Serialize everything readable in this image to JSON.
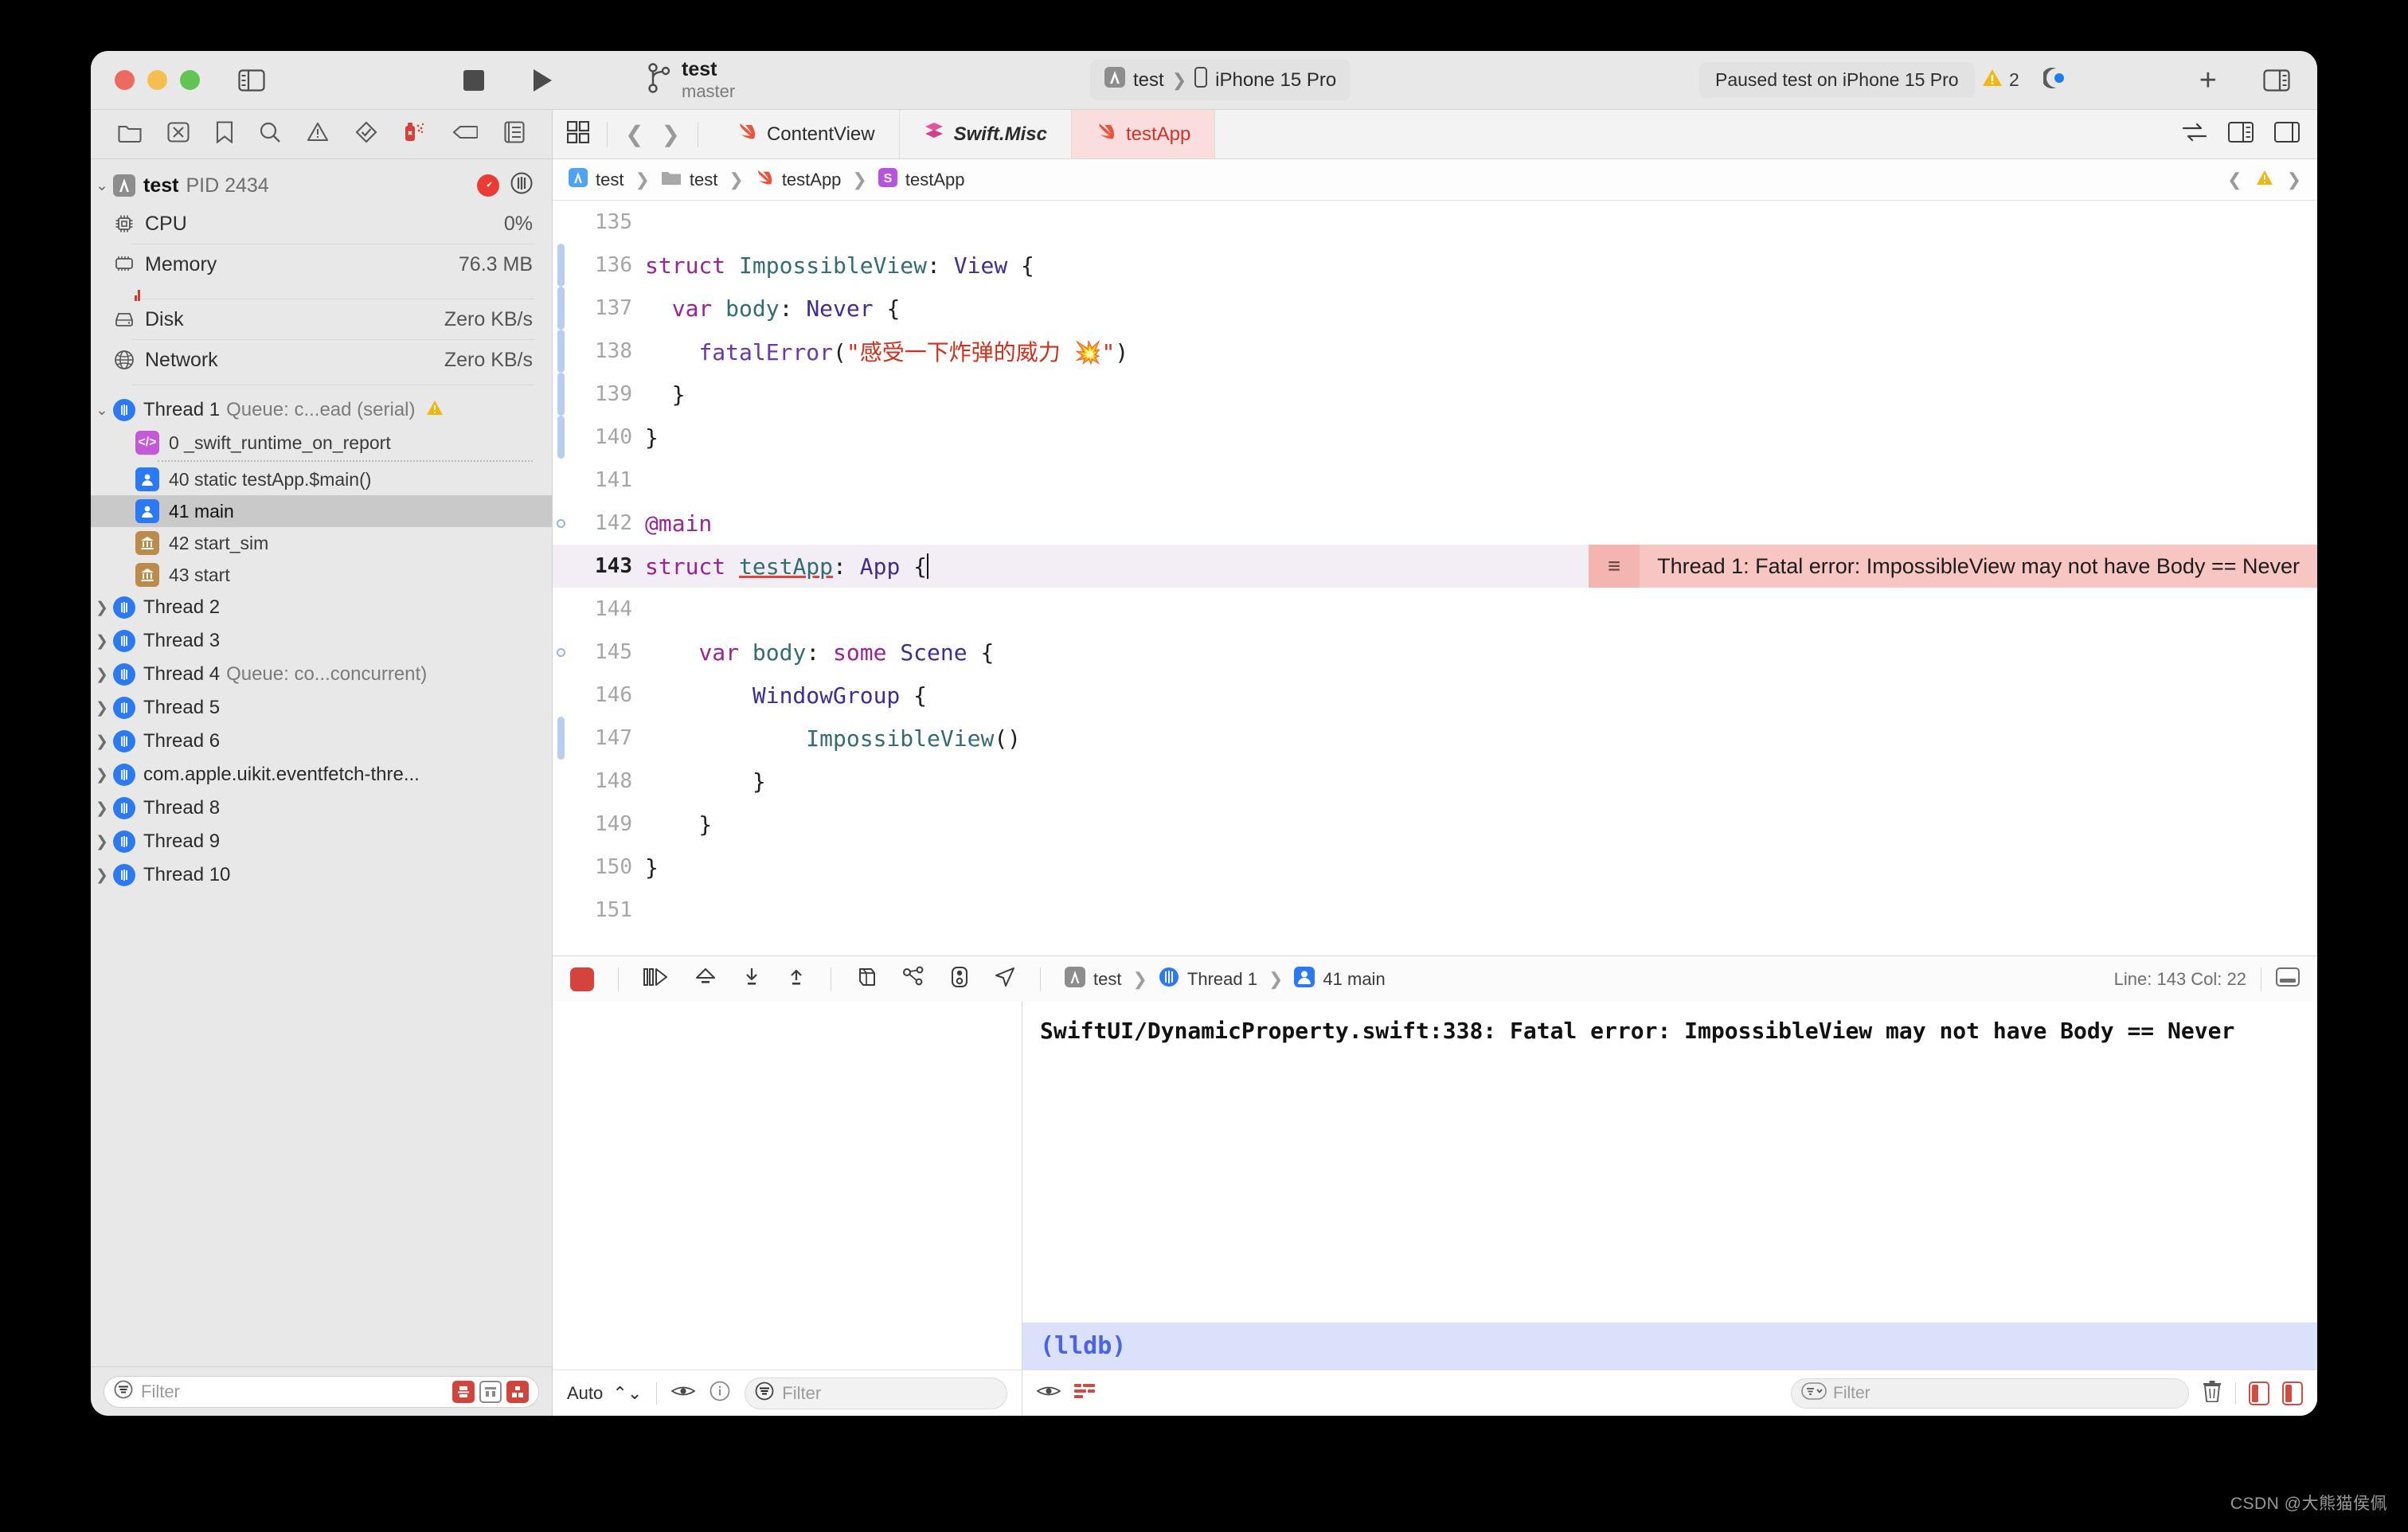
{
  "window": {
    "traffic": [
      "close",
      "minimize",
      "zoom"
    ]
  },
  "toolbar": {
    "project_name": "test",
    "branch": "master",
    "scheme_target": "test",
    "scheme_device": "iPhone 15 Pro",
    "status": "Paused test on iPhone 15 Pro",
    "warning_count": "2",
    "add_label": "+",
    "icons": {
      "sidebar_toggle": "sidebar-left-icon",
      "stop": "stop-icon",
      "run": "run-icon",
      "branch": "source-control-branch-icon",
      "app": "app-icon",
      "device": "iphone-icon",
      "warning": "warning-triangle-icon",
      "activity": "activity-icon",
      "add": "add-icon",
      "inspector_toggle": "sidebar-right-icon"
    }
  },
  "navigator": {
    "tabs": [
      "folder-icon",
      "source-control-icon",
      "bookmark-icon",
      "search-icon",
      "warning-triangle-icon",
      "test-diamond-icon",
      "debug-spray-icon",
      "breakpoint-tag-icon",
      "report-list-icon"
    ],
    "process": {
      "name": "test",
      "pid": "PID 2434",
      "gauge_badge": "performance-gauge-icon",
      "thread_badge": "thread-icon"
    },
    "gauges": [
      {
        "icon": "cpu-icon",
        "label": "CPU",
        "value": "0%"
      },
      {
        "icon": "memory-icon",
        "label": "Memory",
        "value": "76.3 MB"
      },
      {
        "icon": "disk-icon",
        "label": "Disk",
        "value": "Zero KB/s"
      },
      {
        "icon": "network-icon",
        "label": "Network",
        "value": "Zero KB/s"
      }
    ],
    "thread1": {
      "name": "Thread 1",
      "queue": "Queue: c...ead (serial)",
      "warning": "warning-triangle-icon"
    },
    "frames": [
      {
        "label": "0 _swift_runtime_on_report",
        "icon": "code-frame-icon",
        "kind": "purple",
        "selected": false
      },
      {
        "label": "40 static testApp.$main()",
        "icon": "user-frame-icon",
        "kind": "blue",
        "selected": false
      },
      {
        "label": "41 main",
        "icon": "user-frame-icon",
        "kind": "blue",
        "selected": true
      },
      {
        "label": "42 start_sim",
        "icon": "system-frame-icon",
        "kind": "tan",
        "selected": false
      },
      {
        "label": "43 start",
        "icon": "system-frame-icon",
        "kind": "tan",
        "selected": false
      }
    ],
    "threads": [
      {
        "name": "Thread 2",
        "queue": ""
      },
      {
        "name": "Thread 3",
        "queue": ""
      },
      {
        "name": "Thread 4",
        "queue": "Queue: co...concurrent)"
      },
      {
        "name": "Thread 5",
        "queue": ""
      },
      {
        "name": "Thread 6",
        "queue": ""
      },
      {
        "name": "com.apple.uikit.eventfetch-thre...",
        "queue": ""
      },
      {
        "name": "Thread 8",
        "queue": ""
      },
      {
        "name": "Thread 9",
        "queue": ""
      },
      {
        "name": "Thread 10",
        "queue": ""
      }
    ],
    "filter_placeholder": "Filter"
  },
  "editor": {
    "tabs": [
      {
        "label": "ContentView",
        "icon": "swift-file-icon",
        "active": false,
        "italic": false
      },
      {
        "label": "Swift.Misc",
        "icon": "swift-module-icon",
        "active": false,
        "italic": true
      },
      {
        "label": "testApp",
        "icon": "swift-file-icon",
        "active": true,
        "italic": false
      }
    ],
    "breadcrumb": [
      {
        "label": "test",
        "icon": "project-icon"
      },
      {
        "label": "test",
        "icon": "folder-icon"
      },
      {
        "label": "testApp",
        "icon": "swift-file-icon"
      },
      {
        "label": "testApp",
        "icon": "symbol-struct-icon"
      }
    ],
    "code_lines": [
      {
        "n": "135",
        "segments": [],
        "marker": "",
        "current": false
      },
      {
        "n": "136",
        "marker": "bar",
        "current": false,
        "segments": [
          {
            "t": "struct ",
            "c": "kw"
          },
          {
            "t": "ImpossibleView",
            "c": "ident-teal"
          },
          {
            "t": ": ",
            "c": "plain"
          },
          {
            "t": "View",
            "c": "type"
          },
          {
            "t": " {",
            "c": "plain"
          }
        ]
      },
      {
        "n": "137",
        "marker": "bar",
        "current": false,
        "segments": [
          {
            "t": "  ",
            "c": "plain"
          },
          {
            "t": "var ",
            "c": "kw"
          },
          {
            "t": "body",
            "c": "ident-teal"
          },
          {
            "t": ": ",
            "c": "plain"
          },
          {
            "t": "Never",
            "c": "type"
          },
          {
            "t": " {",
            "c": "plain"
          }
        ]
      },
      {
        "n": "138",
        "marker": "bar",
        "current": false,
        "segments": [
          {
            "t": "    ",
            "c": "plain"
          },
          {
            "t": "fatalError",
            "c": "fn"
          },
          {
            "t": "(",
            "c": "plain"
          },
          {
            "t": "\"感受一下炸弹的威力 💥\"",
            "c": "str"
          },
          {
            "t": ")",
            "c": "plain"
          }
        ]
      },
      {
        "n": "139",
        "marker": "bar",
        "current": false,
        "segments": [
          {
            "t": "  }",
            "c": "plain"
          }
        ]
      },
      {
        "n": "140",
        "marker": "bar",
        "current": false,
        "segments": [
          {
            "t": "}",
            "c": "plain"
          }
        ]
      },
      {
        "n": "141",
        "marker": "",
        "current": false,
        "segments": []
      },
      {
        "n": "142",
        "marker": "circ",
        "current": false,
        "segments": [
          {
            "t": "@main",
            "c": "kw"
          }
        ]
      },
      {
        "n": "143",
        "marker": "",
        "current": true,
        "segments": [
          {
            "t": "struct ",
            "c": "kw"
          },
          {
            "t": "testApp",
            "c": "ident-teal under-red"
          },
          {
            "t": ": ",
            "c": "plain"
          },
          {
            "t": "App",
            "c": "type"
          },
          {
            "t": " {",
            "c": "plain"
          }
        ]
      },
      {
        "n": "144",
        "marker": "",
        "current": false,
        "segments": []
      },
      {
        "n": "145",
        "marker": "circ",
        "current": false,
        "segments": [
          {
            "t": "    ",
            "c": "plain"
          },
          {
            "t": "var ",
            "c": "kw"
          },
          {
            "t": "body",
            "c": "ident-teal"
          },
          {
            "t": ": ",
            "c": "plain"
          },
          {
            "t": "some ",
            "c": "kw"
          },
          {
            "t": "Scene",
            "c": "type"
          },
          {
            "t": " {",
            "c": "plain"
          }
        ]
      },
      {
        "n": "146",
        "marker": "",
        "current": false,
        "segments": [
          {
            "t": "        ",
            "c": "plain"
          },
          {
            "t": "WindowGroup",
            "c": "type"
          },
          {
            "t": " {",
            "c": "plain"
          }
        ]
      },
      {
        "n": "147",
        "marker": "bar",
        "current": false,
        "segments": [
          {
            "t": "            ",
            "c": "plain"
          },
          {
            "t": "ImpossibleView",
            "c": "ident-teal"
          },
          {
            "t": "()",
            "c": "plain"
          }
        ]
      },
      {
        "n": "148",
        "marker": "",
        "current": false,
        "segments": [
          {
            "t": "        }",
            "c": "plain"
          }
        ]
      },
      {
        "n": "149",
        "marker": "",
        "current": false,
        "segments": [
          {
            "t": "    }",
            "c": "plain"
          }
        ]
      },
      {
        "n": "150",
        "marker": "",
        "current": false,
        "segments": [
          {
            "t": "}",
            "c": "plain"
          }
        ]
      },
      {
        "n": "151",
        "marker": "",
        "current": false,
        "segments": []
      }
    ],
    "error_banner": "Thread 1: Fatal error: ImpossibleView may not have Body == Never"
  },
  "debug_bar": {
    "buttons": [
      "stop-icon",
      "continue-icon",
      "step-over-icon",
      "step-into-icon",
      "step-out-icon",
      "view-hierarchy-icon",
      "memory-graph-icon",
      "environment-overrides-icon",
      "simulate-location-icon"
    ],
    "crumb": [
      {
        "label": "test",
        "icon": "project-icon"
      },
      {
        "label": "Thread 1",
        "icon": "thread-icon"
      },
      {
        "label": "41 main",
        "icon": "user-frame-icon"
      }
    ],
    "position": "Line: 143  Col: 22",
    "layout_icon": "console-layout-icon"
  },
  "variables_pane": {
    "scope": "Auto",
    "icons": [
      "eye-icon",
      "info-icon"
    ],
    "filter_placeholder": "Filter"
  },
  "console": {
    "output": "SwiftUI/DynamicProperty.swift:338: Fatal error: ImpossibleView may not have Body == Never",
    "prompt": "(lldb)",
    "filter_placeholder": "Filter",
    "icons": [
      "eye-icon",
      "metadata-icon",
      "trash-icon",
      "left-panel-icon",
      "right-panel-icon"
    ]
  },
  "watermark": "CSDN @大熊猫侯佩",
  "colors": {
    "accent_red": "#d2322a",
    "error_banner_bg": "#f7c6c2",
    "current_line_bg": "#f3edf5",
    "lldb_bg": "#dbe0fb",
    "lldb_fg": "#4a63e8",
    "thread_blue": "#2b79f5"
  }
}
